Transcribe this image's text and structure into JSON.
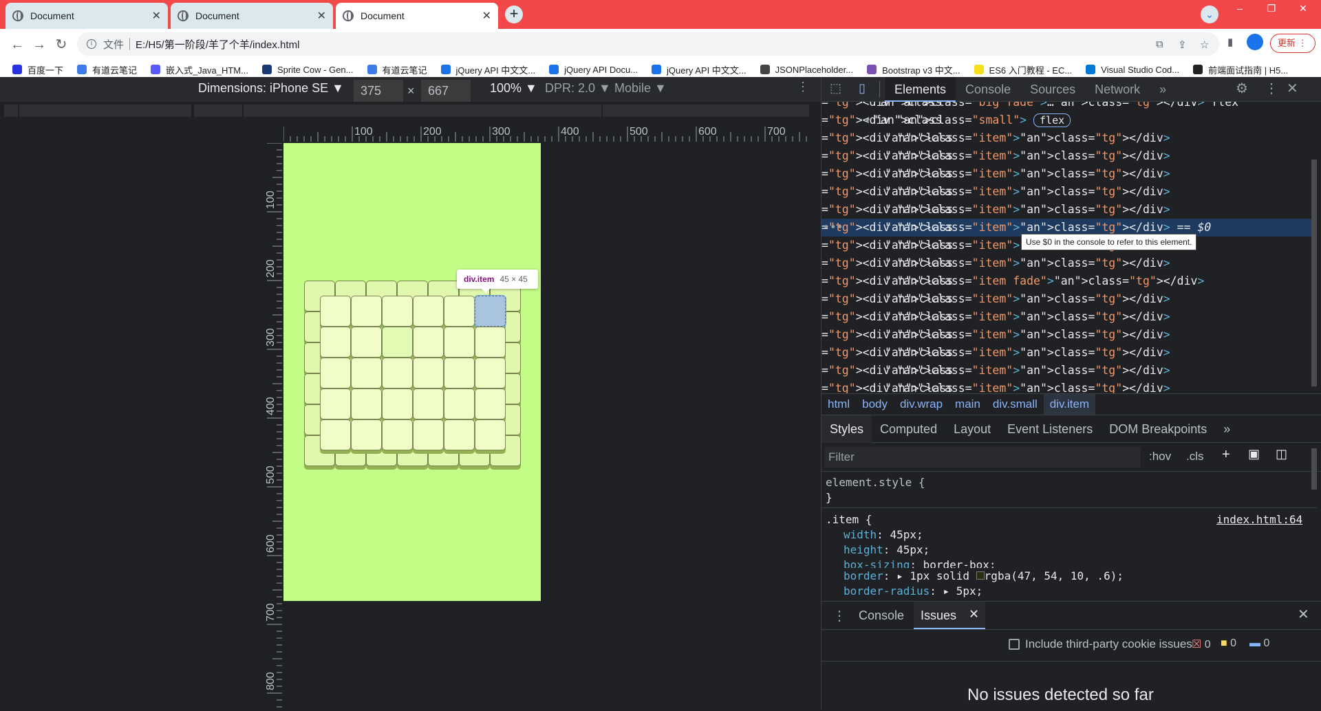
{
  "tabs": [
    {
      "title": "Document"
    },
    {
      "title": "Document"
    },
    {
      "title": "Document"
    }
  ],
  "address": {
    "security_label": "文件",
    "url": "E:/H5/第一阶段/羊了个羊/index.html"
  },
  "update_label": "更新",
  "bookmarks": [
    "百度一下",
    "有道云笔记",
    "嵌入式_Java_HTM...",
    "Sprite Cow - Gen...",
    "有道云笔记",
    "jQuery API 中文文...",
    "jQuery API Docu...",
    "jQuery API 中文文...",
    "JSONPlaceholder...",
    "Bootstrap v3 中文...",
    "ES6 入门教程 - EC...",
    "Visual Studio Cod...",
    "前端面试指南 | H5..."
  ],
  "device_toolbar": {
    "dimensions_label": "Dimensions: iPhone SE",
    "width": "375",
    "height": "667",
    "times": "×",
    "zoom": "100%",
    "dpr": "DPR: 2.0",
    "mode": "Mobile"
  },
  "ruler_h": [
    "100",
    "200",
    "300",
    "400",
    "500",
    "600",
    "700"
  ],
  "ruler_v": [
    "100",
    "200",
    "300",
    "400",
    "500",
    "600",
    "700",
    "800"
  ],
  "tooltip": {
    "name": "div.item",
    "size": "45 × 45"
  },
  "devtools": {
    "tabs": [
      "Elements",
      "Console",
      "Sources",
      "Network"
    ],
    "more": "»",
    "dom_lines": [
      {
        "text": "<div class=\"big fade\">…</div> flex"
      },
      {
        "text": "<div class=\"small\">",
        "badge": "flex"
      },
      {
        "text": "<div class=\"item\"></div>"
      },
      {
        "text": "<div class=\"item\"></div>"
      },
      {
        "text": "<div class=\"item\"></div>"
      },
      {
        "text": "<div class=\"item\"></div>"
      },
      {
        "text": "<div class=\"item\"></div>"
      },
      {
        "text": "<div class=\"item\"></div>",
        "suffix": " == $0"
      },
      {
        "text": "<div class=\"item\"></div>"
      },
      {
        "text": "<div class=\"item\"></div>"
      },
      {
        "text": "<div class=\"item fade\"></div>"
      },
      {
        "text": "<div class=\"item\"></div>"
      },
      {
        "text": "<div class=\"item\"></div>"
      },
      {
        "text": "<div class=\"item\"></div>"
      },
      {
        "text": "<div class=\"item\"></div>"
      },
      {
        "text": "<div class=\"item\"></div>"
      },
      {
        "text": "<div class=\"item\"></div>"
      }
    ],
    "console_hint": "Use $0 in the console to refer to this element.",
    "breadcrumbs": [
      "html",
      "body",
      "div.wrap",
      "main",
      "div.small",
      "div.item"
    ],
    "style_tabs": [
      "Styles",
      "Computed",
      "Layout",
      "Event Listeners",
      "DOM Breakpoints"
    ],
    "filter_placeholder": "Filter",
    "hov": ":hov",
    "cls": ".cls",
    "styles": {
      "element_style": "element.style {",
      "close": "}",
      "selector": ".item {",
      "source": "index.html:64",
      "props": [
        {
          "name": "width",
          "value": "45px;"
        },
        {
          "name": "height",
          "value": "45px;"
        },
        {
          "name": "box-sizing",
          "value": "border-box;"
        },
        {
          "name": "border",
          "value": "1px solid",
          "color": "rgba(47, 54, 10, .6);"
        },
        {
          "name": "border-radius",
          "value": "5px;"
        }
      ]
    },
    "drawer": {
      "tabs": [
        "Console",
        "Issues"
      ],
      "third_party": "Include third-party cookie issues",
      "counts": [
        "0",
        "0",
        "0"
      ],
      "empty": "No issues detected so far"
    }
  },
  "colors": {
    "tabbar": "#f2484a",
    "phone_bg": "#c4fd86",
    "tile": "#f1fdc6",
    "accent": "#8ab4f8"
  }
}
